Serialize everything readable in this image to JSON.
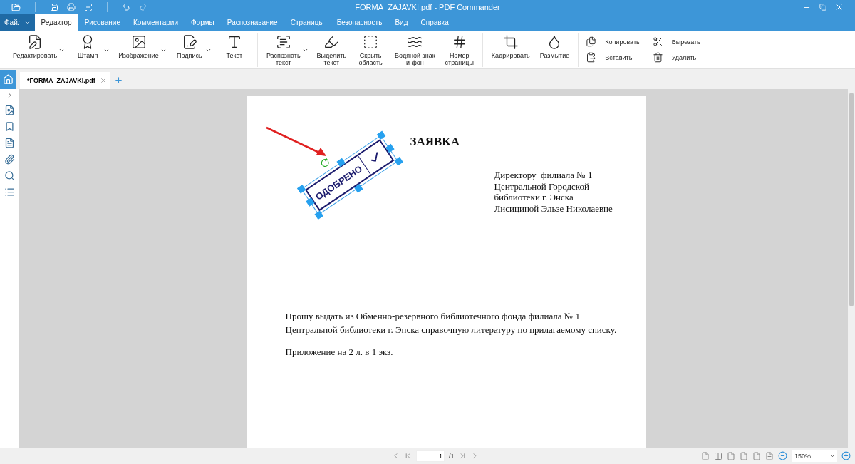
{
  "window": {
    "title": "FORMA_ZAJAVKI.pdf - PDF Commander"
  },
  "file_menu": {
    "label": "Файл"
  },
  "menu_tabs": [
    {
      "label": "Редактор",
      "selected": true
    },
    {
      "label": "Рисование",
      "selected": false
    },
    {
      "label": "Комментарии",
      "selected": false
    },
    {
      "label": "Формы",
      "selected": false
    },
    {
      "label": "Распознавание",
      "selected": false
    },
    {
      "label": "Страницы",
      "selected": false
    },
    {
      "label": "Безопасность",
      "selected": false
    },
    {
      "label": "Вид",
      "selected": false
    },
    {
      "label": "Справка",
      "selected": false
    }
  ],
  "ribbon_groups": [
    [
      {
        "label": "Редактировать",
        "has_menu": true
      },
      {
        "label": "Штамп",
        "has_menu": true
      },
      {
        "label": "Изображение",
        "has_menu": true
      },
      {
        "label": "Подпись",
        "has_menu": true
      },
      {
        "label": "Текст",
        "has_menu": false
      }
    ],
    [
      {
        "label": "Распознать\nтекст",
        "has_menu": true
      },
      {
        "label": "Выделить\nтекст",
        "has_menu": false
      },
      {
        "label": "Скрыть\nобласть",
        "has_menu": false
      },
      {
        "label": "Водяной знак\nи фон",
        "has_menu": false
      },
      {
        "label": "Номер\nстраницы",
        "has_menu": false
      }
    ],
    [
      {
        "label": "Кадрировать",
        "has_menu": false
      },
      {
        "label": "Размытие",
        "has_menu": false
      }
    ]
  ],
  "clipboard": [
    {
      "label": "Копировать"
    },
    {
      "label": "Вставить"
    },
    {
      "label": "Вырезать"
    },
    {
      "label": "Удалить"
    }
  ],
  "doc_tabs": [
    {
      "label": "*FORMA_ZAJAVKI.pdf",
      "selected": true
    }
  ],
  "document": {
    "stamp": {
      "label": "ОДОБРЕНО",
      "selected": true
    },
    "heading": "ЗАЯВКА",
    "addressee": [
      "Директору  филиала № 1",
      "Центральной Городской",
      "библиотеки г. Энска",
      "Лисициной Эльзе Николаевне"
    ],
    "body": [
      "Прошу выдать из Обменно-резервного библиотечного фонда филиала № 1",
      "Центральной библиотеки г. Энска справочную литературу по прилагаемому списку."
    ],
    "attachment": "Приложение на 2 л. в 1 экз."
  },
  "status_bar": {
    "page": "1",
    "page_total": "/1",
    "zoom": "150%"
  }
}
